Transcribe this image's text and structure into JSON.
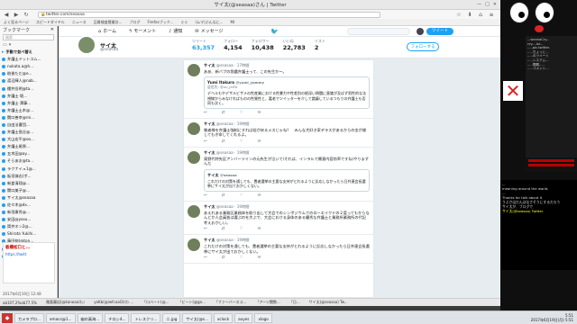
{
  "window": {
    "title": "サイ太(@seasaa)さん | Twitter"
  },
  "address": {
    "url": "twitter.com/seasaa"
  },
  "bookmarks_toolbar": [
    "よく見るページ",
    "スピードダイヤル",
    "ニュース",
    "品質検査競業計...",
    "ブログ",
    "Firefoxブック...",
    "ぐぐ",
    "(ムマ)ぶんなに...",
    "MI"
  ],
  "sidebar": {
    "title": "ブックマーク",
    "search_placeholder": "検索",
    "items": [
      {
        "label": "手動で並べ替え",
        "folder": true
      },
      {
        "label": "弁護士ドットコム..."
      },
      {
        "label": "nukata.a@h..."
      },
      {
        "label": "粕香ただ@e..."
      },
      {
        "label": "渡辺輝人@nab..."
      },
      {
        "label": "櫻井岳明@ta..."
      },
      {
        "label": "弁護士 堀..."
      },
      {
        "label": "弁護士 澤藤..."
      },
      {
        "label": "弁護士土木@..."
      },
      {
        "label": "関口善幸@mi..."
      },
      {
        "label": "自由法曹団..."
      },
      {
        "label": "弁護士島谷@..."
      },
      {
        "label": "大山宏平@oo..."
      },
      {
        "label": "弁護士尾原..."
      },
      {
        "label": "五木田@ay..."
      },
      {
        "label": "そらあお@ta..."
      },
      {
        "label": "ラクナイュ1@..."
      },
      {
        "label": "板垣嶺志(ポ..."
      },
      {
        "label": "新倉清翔@..."
      },
      {
        "label": "関口美子@..."
      },
      {
        "label": "サイ太@seasaa"
      },
      {
        "label": "佐々木@dx..."
      },
      {
        "label": "新垣康秀@..."
      },
      {
        "label": "安田@yasu..."
      },
      {
        "label": "筒井ネン2@..."
      },
      {
        "label": "Shirota Yukihi..."
      },
      {
        "label": "藤田伸(@ton..."
      },
      {
        "label": "Kenji NAGATA..."
      },
      {
        "label": "平井 光・はは..."
      }
    ],
    "preview": {
      "title": "板橋松口と...",
      "url": "https://twitt"
    },
    "status": "2017年6月19日 12:48"
  },
  "twitter": {
    "nav": {
      "home": "ホーム",
      "moments": "モーメント",
      "notifications": "通知",
      "messages": "メッセージ",
      "tweet_button": "ツイート"
    },
    "profile": {
      "name": "サイ太",
      "handle": "@seasaa",
      "stats": [
        {
          "label": "ツイート",
          "value": "63,357"
        },
        {
          "label": "フォロー",
          "value": "4,154"
        },
        {
          "label": "フォロワー",
          "value": "10,438"
        },
        {
          "label": "いいね",
          "value": "22,783"
        },
        {
          "label": "リスト",
          "value": "2"
        }
      ],
      "follow_button": "フォローする"
    },
    "tweets": [
      {
        "name": "サイ太",
        "handle": "@seasaa",
        "time": "17時間",
        "text": "ああ、新バブの我儘弁護士って、この先生か～。",
        "quote": {
          "name": "Yumi Itakura",
          "handle": "@yumi_yammy",
          "meta": "返信先: @nu_jinFA",
          "text": "デベルもやデザルビザメの性産業における性暴力や性差別の根深い問題に意識が及ばず男性的な法視線からみなければものの性質性と、嘉老でツイッターを介して論議しているつもりの弁護士も否同も次く。"
        }
      },
      {
        "name": "サイ太",
        "handle": "@seasaa",
        "time": "19時間",
        "text": "貧者様を弁護士強制にすれば若が戻るメスじゃね？　みんな大好き家デラスがあるからの金が貸してもぎ命してくれるよ。"
      },
      {
        "name": "サイ太",
        "handle": "@seasaa",
        "time": "19時間",
        "text": "東野代特先区アンバーツインの元先生が泣いて(それは、インラルで賛意内容効率ですね)やりまずんだ",
        "quote": {
          "name": "サイ太",
          "handle": "@seasaa",
          "meta": "",
          "text": "これだけの対策を通しても、豊者選挙の主要な支持がとれるように反応しなかったら日弁連会長選挙にサイ太が出ておかしくない。"
        }
      },
      {
        "name": "サイ太",
        "handle": "@seasaa",
        "time": "19時間",
        "text": "あえれある業務区業務体を取り出して大会でのシンポジウムでのローエイクドの２度ってもからなんとか人会員皆は選ぶのを大ぶで、大会における身体のある優秀な弁護士と業務所業務所の代記考えおかしい。"
      },
      {
        "name": "サイ太",
        "handle": "@seasaa",
        "time": "19時間",
        "text": "これだけの対策を通しても、豊者選挙の主要な支持がとれるように反応しなかったら日弁連会長選挙にサイ太が出ておかしくない。"
      }
    ]
  },
  "terminal": {
    "lines": [
      "...wannaCry...",
      "cry....lol...",
      "…..pic.twitter.",
      "…..ちょっと...",
      "…..のツイート",
      "…..システム...",
      "…..問題.....",
      "…..コメント..."
    ],
    "bottom_lines": [
      "...",
      "meaning around the world.",
      "...",
      "Thanks for talk about it",
      "うぶさはだんはなさそうにするだろう",
      "サイ太が、ブログで"
    ],
    "prompt_line": "サイ太(@seasaa) Twitter"
  },
  "statusbar": {
    "items": [
      "ab107.2%ab77.5%",
      "雅喜藤記(@kanoaa)(い",
      "yoKb(@iwfcaaO)(わ ...",
      "「ロバート(@...",
      "「ビート(@ga...",
      "「ファーバースコ...",
      "「アーツ関数...",
      "「日...",
      "サイ太(@seasaa) Tw..."
    ]
  },
  "taskbar": {
    "items": [
      "カメラプロ...",
      "emacs@1...",
      "幽の真海...",
      "チロシ4...",
      "トレスクリ...",
      "二.jpg",
      "サイ太(@s...",
      "xclock",
      "axyes",
      "xlogo"
    ],
    "clock_time": "5:51",
    "clock_date": "2017年6月19日(月) 5:51"
  },
  "colors": {
    "twitter_blue": "#1da1f2",
    "bg": "#e6ecf0"
  }
}
